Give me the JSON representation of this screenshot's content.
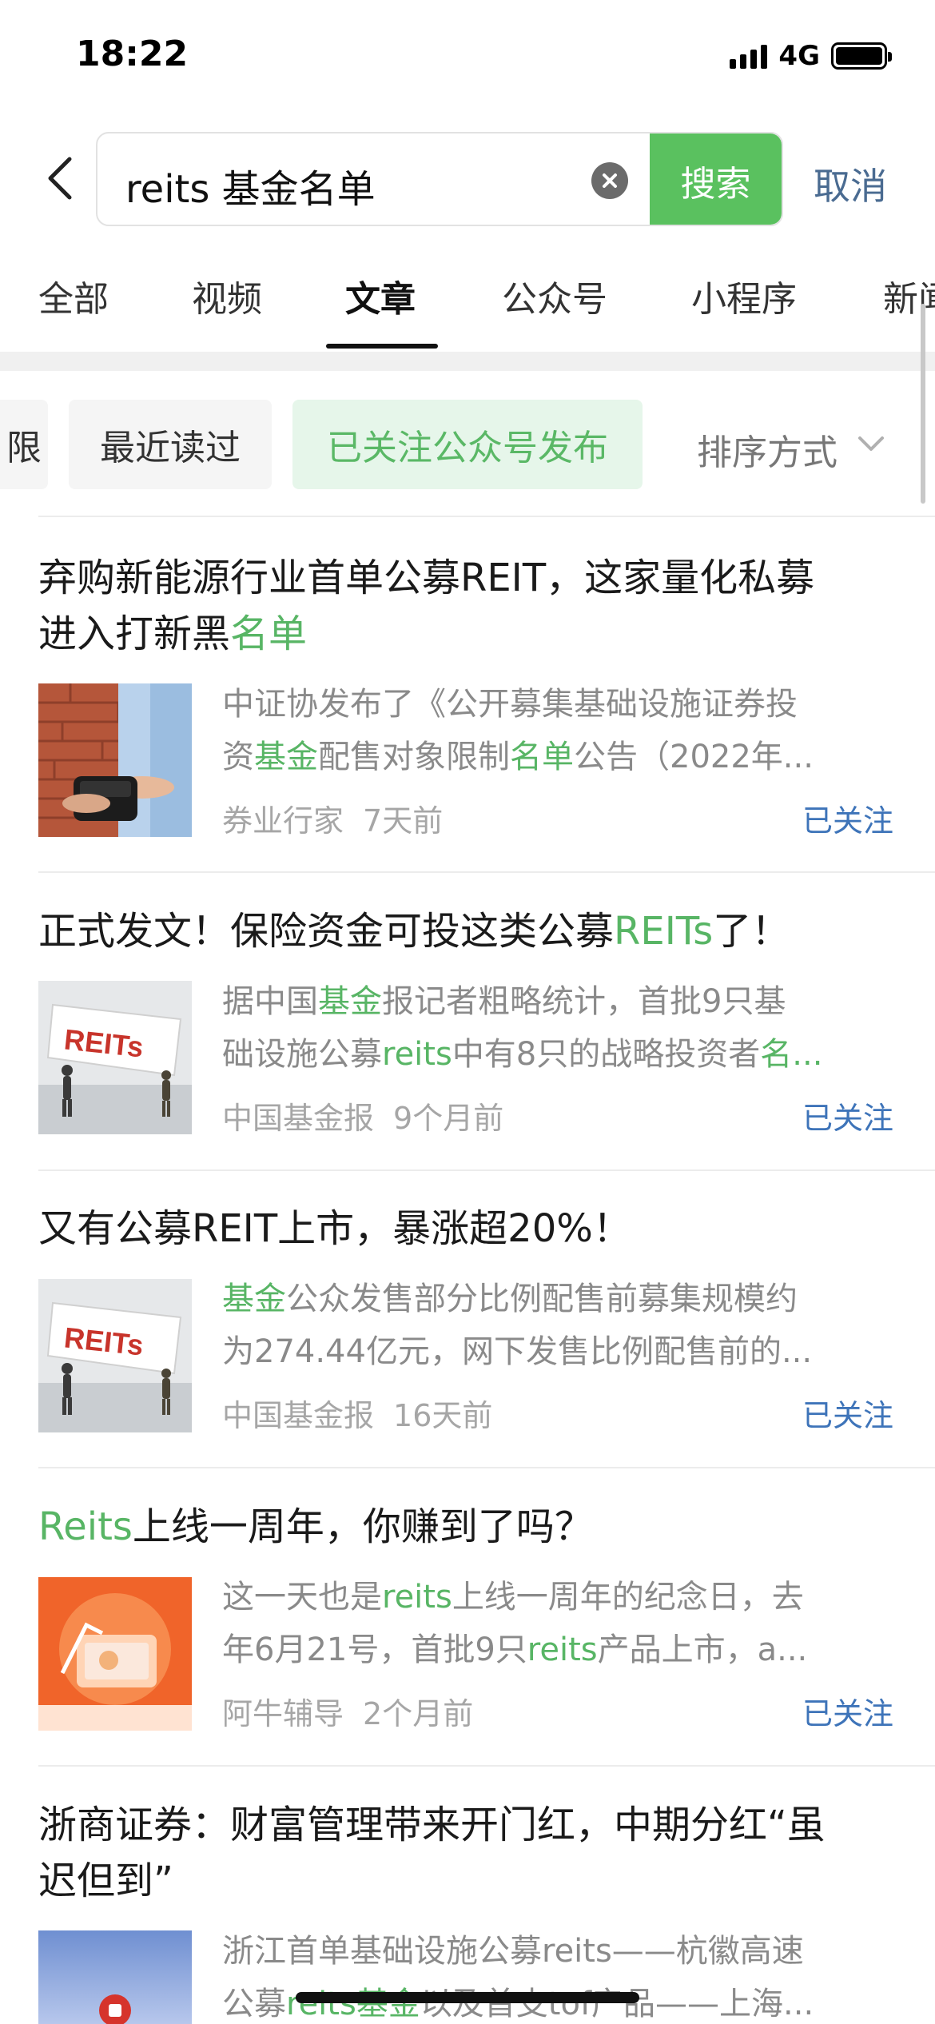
{
  "status": {
    "time": "18:22",
    "network": "4G"
  },
  "search": {
    "query": "reits 基金名单",
    "button_label": "搜索",
    "cancel_label": "取消"
  },
  "tabs": [
    {
      "label": "全部"
    },
    {
      "label": "视频"
    },
    {
      "label": "文章",
      "active": true
    },
    {
      "label": "公众号"
    },
    {
      "label": "小程序"
    },
    {
      "label": "新闻"
    }
  ],
  "filters": {
    "partial_chip": "限",
    "recent_chip": "最近读过",
    "followed_chip": "已关注公众号发布",
    "sort_label": "排序方式"
  },
  "articles": [
    {
      "title_a": "弃购新能源行业首单公募REIT，这家量化私募",
      "title_b": "进入打新黑",
      "title_hl": "名单",
      "snip1_a": "中证协发布了《公开募集基础设施证券投",
      "snip2_a": "资",
      "snip2_hl1": "基金",
      "snip2_b": "配售对象限制",
      "snip2_hl2": "名单",
      "snip2_c": "公告（2022年...",
      "source": "券业行家",
      "time": "7天前",
      "follow": "已关注"
    },
    {
      "title_a": "正式发文！保险资金可投这类公募",
      "title_hl": "REITs",
      "title_b": "了！",
      "snip1_a": "据中国",
      "snip1_hl": "基金",
      "snip1_b": "报记者粗略统计，首批9只基",
      "snip2_a": "础设施公募",
      "snip2_hl1": "reits",
      "snip2_b": "中有8只的战略投资者",
      "snip2_hl2": "名...",
      "thumb_text": "REITs",
      "source": "中国基金报",
      "time": "9个月前",
      "follow": "已关注"
    },
    {
      "title": "又有公募REIT上市，暴涨超20%！",
      "snip1_hl": "基金",
      "snip1_b": "公众发售部分比例配售前募集规模约",
      "snip2_a": "为274.44亿元，网下发售比例配售前的...",
      "thumb_text": "REITs",
      "source": "中国基金报",
      "time": "16天前",
      "follow": "已关注"
    },
    {
      "title_hl": "Reits",
      "title_b": "上线一周年，你赚到了吗？",
      "snip1_a": "这一天也是",
      "snip1_hl": "reits",
      "snip1_b": "上线一周年的纪念日，去",
      "snip2_a": "年6月21号，首批9只",
      "snip2_hl": "reits",
      "snip2_b": "产品上市，a...",
      "source": "阿牛辅导",
      "time": "2个月前",
      "follow": "已关注"
    },
    {
      "title_a": "浙商证券：财富管理带来开门红，中期分红“虽",
      "title_b": "迟但到”",
      "snip1_a": "浙江首单基础设施公募reits——杭徽高速",
      "snip2_a": "公募",
      "snip2_hl": "reits基金",
      "snip2_b": "以及首支tof产品——上海..."
    }
  ]
}
